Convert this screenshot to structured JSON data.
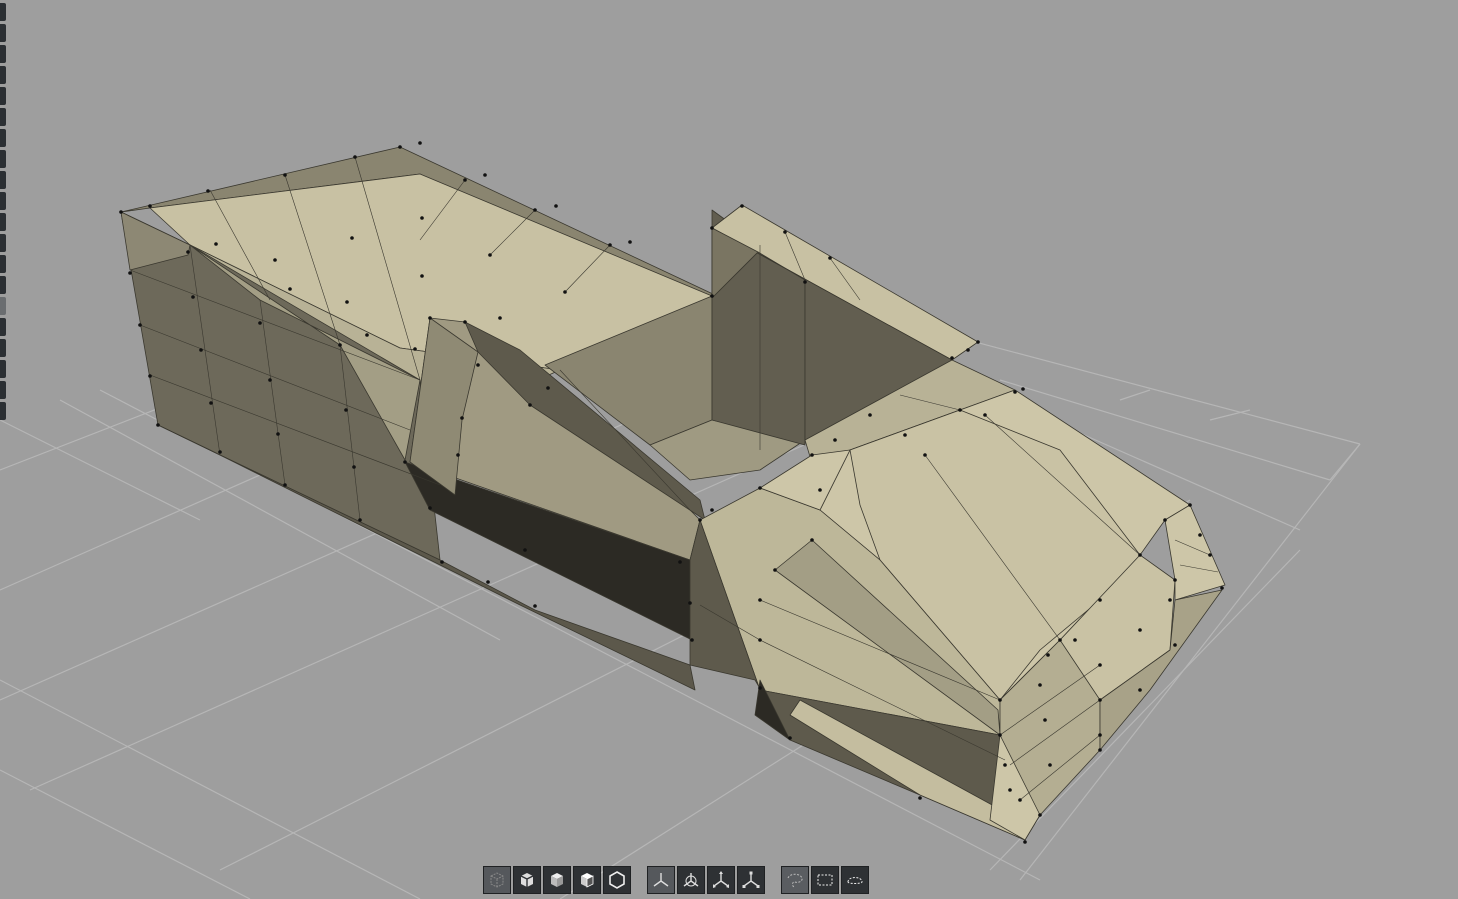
{
  "app": {
    "view": "perspective-viewport"
  },
  "colors": {
    "background": "#9e9e9e",
    "grid": "#b4b4b4",
    "face_light": "#cdc6a8",
    "face_mid": "#a8a288",
    "face_dark": "#625e50",
    "face_shadow": "#2c2a24",
    "edge": "#3a382f",
    "vertex": "#111111",
    "toolbar_bg": "#2e3134"
  },
  "left_strip": {
    "items": 20,
    "active_index": 14
  },
  "toolbar": {
    "view_buttons": [
      {
        "icon": "wireframe-cube-icon",
        "active": true
      },
      {
        "icon": "flat-shaded-cube-icon",
        "active": false
      },
      {
        "icon": "smooth-shaded-cube-icon",
        "active": false
      },
      {
        "icon": "textured-cube-icon",
        "active": false
      },
      {
        "icon": "hexagon-outline-icon",
        "active": false
      }
    ],
    "gizmo_buttons": [
      {
        "icon": "axis-gizmo-icon",
        "active": true
      },
      {
        "icon": "rotate-gizmo-icon",
        "active": false
      },
      {
        "icon": "move-gizmo-icon",
        "active": false
      },
      {
        "icon": "scale-gizmo-icon",
        "active": false
      }
    ],
    "select_buttons": [
      {
        "icon": "lasso-select-icon",
        "active": false,
        "dim": true
      },
      {
        "icon": "box-select-icon",
        "active": false
      },
      {
        "icon": "ellipse-select-icon",
        "active": false
      }
    ]
  }
}
